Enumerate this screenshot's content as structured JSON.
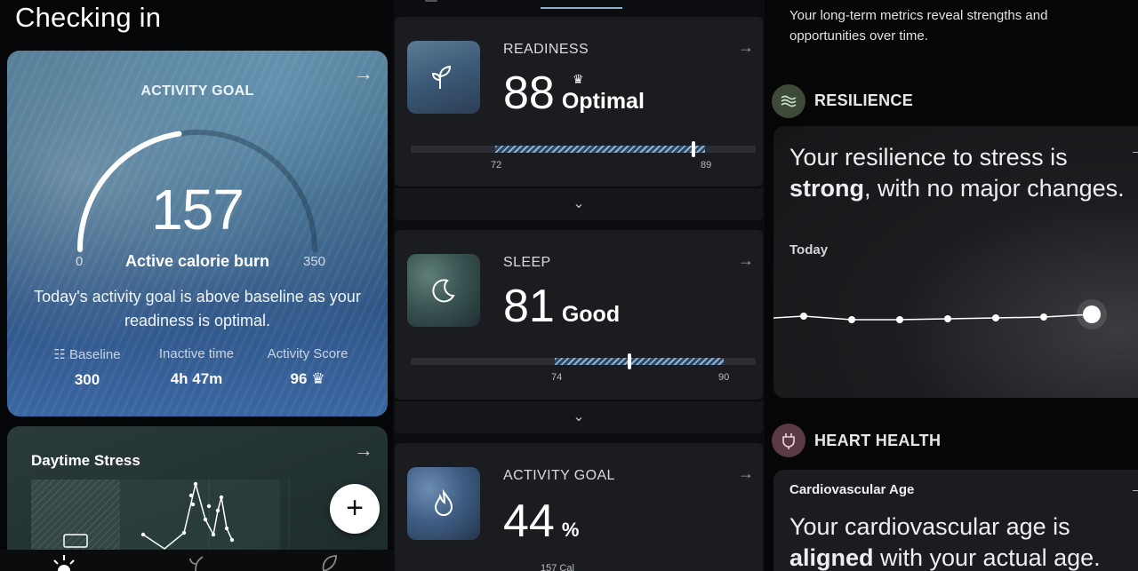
{
  "panel1": {
    "title": "Checking in",
    "activity": {
      "title": "ACTIVITY GOAL",
      "value": "157",
      "min": "0",
      "max": "350",
      "progress": 0.45,
      "label": "Active calorie burn",
      "description": "Today's activity goal is above baseline as your readiness is optimal.",
      "stats": [
        {
          "label": "Baseline",
          "value": "300",
          "icon": "sliders-icon"
        },
        {
          "label": "Inactive time",
          "value": "4h 47m"
        },
        {
          "label": "Activity Score",
          "value": "96",
          "icon": "crown-icon"
        }
      ]
    },
    "stress": {
      "title": "Daytime Stress"
    },
    "fab_label": "+",
    "nav": [
      "sun-icon",
      "sprout-icon",
      "leaf-icon"
    ]
  },
  "panel2": {
    "cards": [
      {
        "label": "READINESS",
        "value": "88",
        "word": "Optimal",
        "range_low": "72",
        "range_high": "89",
        "marker": 88,
        "icon": "sprout-icon"
      },
      {
        "label": "SLEEP",
        "value": "81",
        "word": "Good",
        "range_low": "74",
        "range_high": "90",
        "marker": 81,
        "icon": "moon-icon"
      },
      {
        "label": "ACTIVITY GOAL",
        "value": "44",
        "unit": "%",
        "sub": "157 Cal",
        "icon": "flame-icon"
      }
    ]
  },
  "panel3": {
    "intro": "Your long-term metrics reveal strengths and opportunities over time.",
    "resilience": {
      "title": "RESILIENCE",
      "text_before": "Your resilience to stress is ",
      "text_bold": "strong",
      "text_after": ", with no major changes.",
      "today": "Today"
    },
    "heart": {
      "title": "HEART HEALTH",
      "sub": "Cardiovascular Age",
      "text_before": "Your cardiovascular age is ",
      "text_bold": "aligned",
      "text_after": " with your actual age."
    }
  },
  "colors": {
    "accent_blue": "#8fb3cf",
    "resilience_icon_bg": "#3d4a3a",
    "heart_icon_bg": "#5a3a45"
  }
}
